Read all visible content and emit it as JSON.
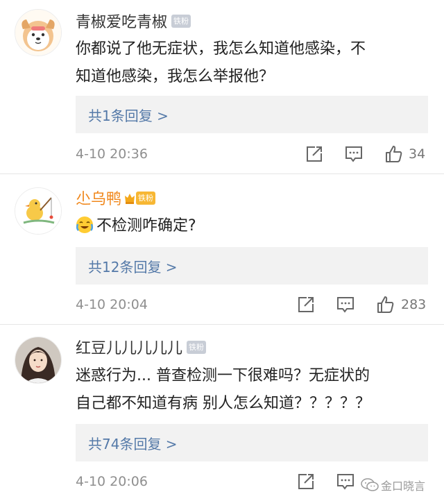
{
  "comments": [
    {
      "username": "青椒爱吃青椒",
      "badge": "铁粉",
      "text_lines": [
        "你都说了他无症状，我怎么知道他感染，不",
        "知道他感染，我怎么举报他？"
      ],
      "reply_label": "共1条回复 >",
      "time": "4-10 20:36",
      "like_count": "34",
      "avatar_icon": "cartoon-dog-avatar"
    },
    {
      "username": "尐乌鸭",
      "badge": "铁粉",
      "emoji_icon": "crying-laughing-emoji",
      "text": "不检测咋确定?",
      "reply_label": "共12条回复 >",
      "time": "4-10 20:04",
      "like_count": "283",
      "avatar_icon": "cartoon-duck-fishing-avatar"
    },
    {
      "username": "红豆儿儿儿儿儿",
      "badge": "铁粉",
      "text_lines": [
        "迷惑行为... 普查检测一下很难吗？无症状的",
        "自己都不知道有病 别人怎么知道？？？？？"
      ],
      "reply_label": "共74条回复 >",
      "time": "4-10 20:06",
      "like_count": "",
      "avatar_icon": "girl-photo-avatar"
    }
  ],
  "watermark": {
    "text": "金口晓言",
    "icon": "wechat-icon"
  },
  "colors": {
    "link": "#5479a8",
    "orange_name": "#f08619",
    "reply_bg": "#f2f2f2",
    "meta": "#8f8f8f"
  }
}
